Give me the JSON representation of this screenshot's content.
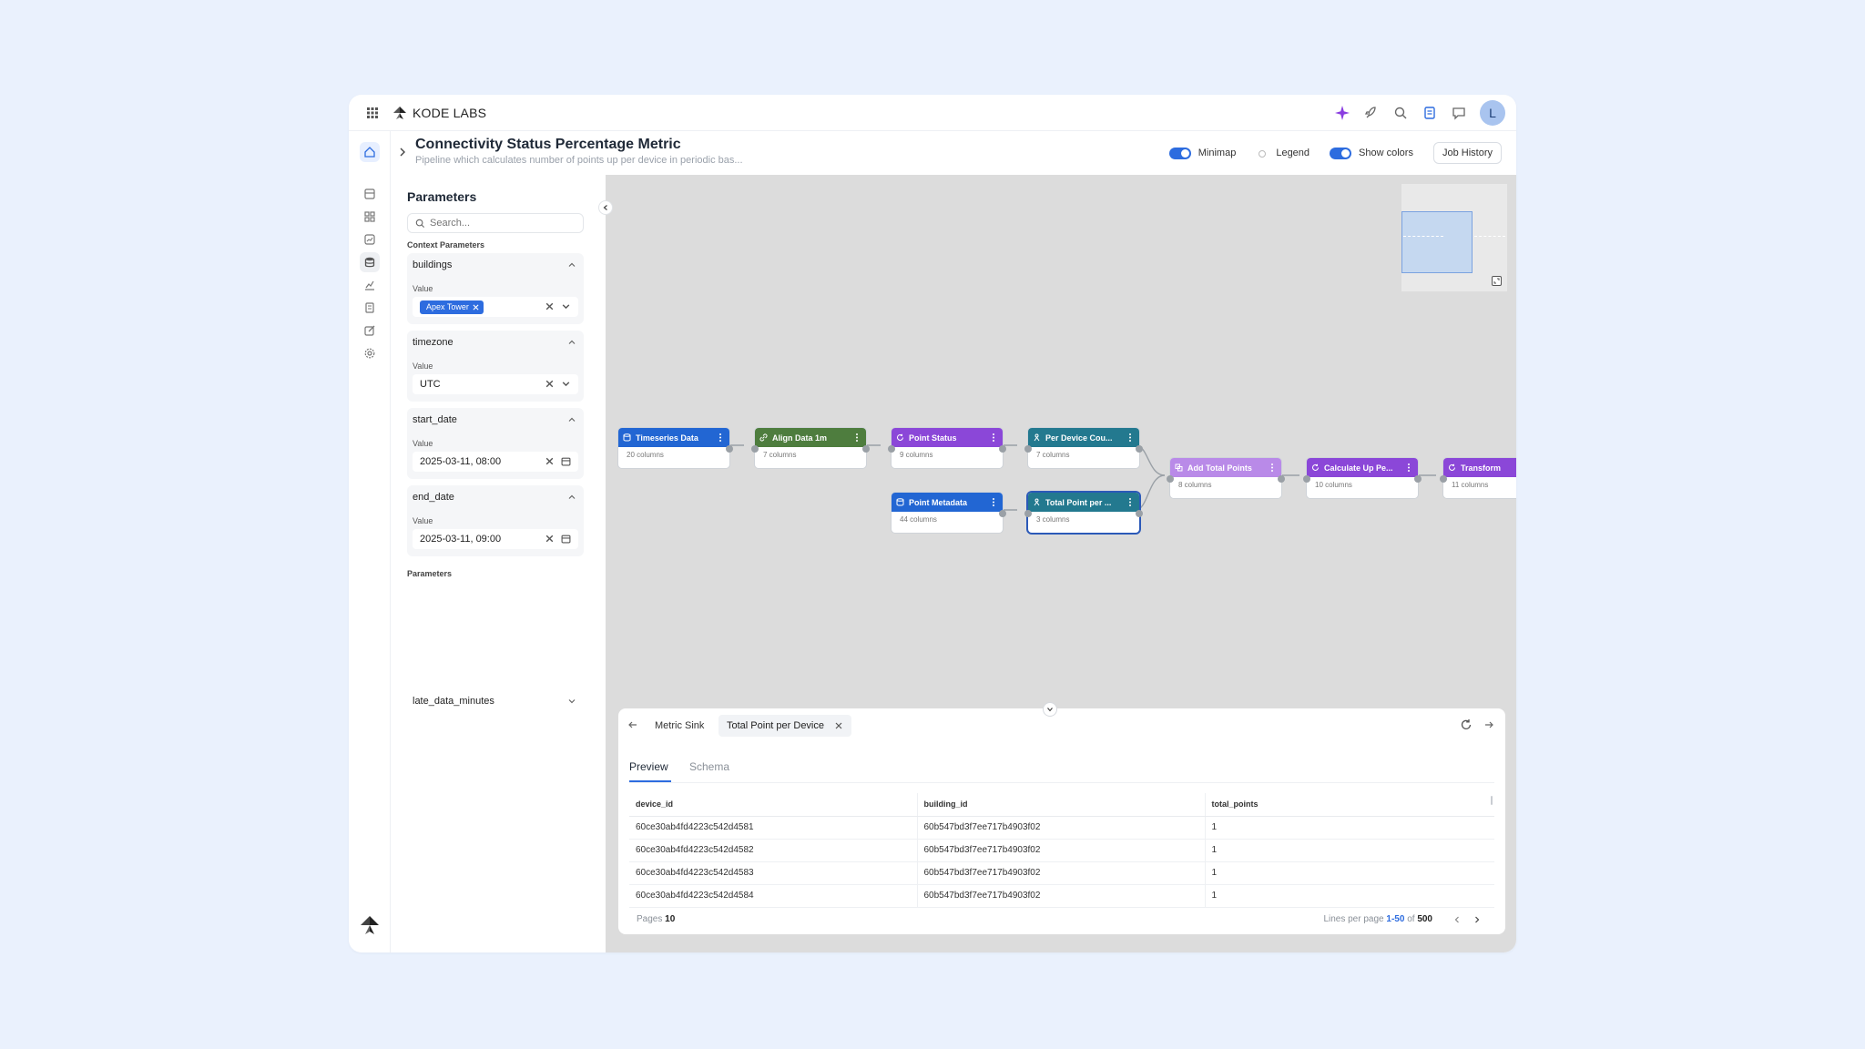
{
  "app": {
    "brand": "KODE LABS",
    "accent": "#2d6cdf",
    "avatar_initial": "L"
  },
  "topbar": {
    "icons": [
      "grid-icon",
      "sparkle-icon",
      "rocket-icon",
      "search-icon",
      "document-icon",
      "chat-icon"
    ]
  },
  "rail": {
    "items": [
      "home-icon",
      "dashboard-icon",
      "apps-icon",
      "analytics-icon",
      "database-icon",
      "chart-icon",
      "report-icon",
      "edit-icon",
      "settings-icon"
    ]
  },
  "header": {
    "title": "Connectivity Status Percentage Metric",
    "subtitle": "Pipeline which calculates number of points up per device in periodic bas...",
    "minimap_label": "Minimap",
    "legend_label": "Legend",
    "show_colors_label": "Show colors",
    "job_history_label": "Job History"
  },
  "params": {
    "title": "Parameters",
    "search_placeholder": "Search...",
    "context_label": "Context Parameters",
    "value_label": "Value",
    "buildings": {
      "name": "buildings",
      "chip": "Apex Tower"
    },
    "timezone": {
      "name": "timezone",
      "value": "UTC"
    },
    "start_date": {
      "name": "start_date",
      "value": "2025-03-11, 08:00"
    },
    "end_date": {
      "name": "end_date",
      "value": "2025-03-11, 09:00"
    },
    "params_label": "Parameters",
    "late": "late_data_minutes"
  },
  "nodes": {
    "timeseries": {
      "title": "Timeseries Data",
      "cols": "20 columns",
      "color": "#2266d3"
    },
    "align": {
      "title": "Align Data 1m",
      "cols": "7 columns",
      "color": "#4e7d3e"
    },
    "point_status": {
      "title": "Point Status",
      "cols": "9 columns",
      "color": "#8b47d8"
    },
    "per_device": {
      "title": "Per Device Cou...",
      "cols": "7 columns",
      "color": "#23798f"
    },
    "point_meta": {
      "title": "Point Metadata",
      "cols": "44 columns",
      "color": "#2266d3"
    },
    "total_point": {
      "title": "Total Point per ...",
      "cols": "3 columns",
      "color": "#23798f"
    },
    "add_total": {
      "title": "Add Total Points",
      "cols": "8 columns",
      "color": "#b98ae8"
    },
    "calc_up": {
      "title": "Calculate Up Pe...",
      "cols": "10 columns",
      "color": "#8b47d8"
    },
    "transform": {
      "title": "Transform",
      "cols": "11 columns",
      "color": "#8b47d8"
    }
  },
  "bottom": {
    "crumb1": "Metric Sink",
    "crumb2": "Total Point per Device",
    "tab_preview": "Preview",
    "tab_schema": "Schema",
    "columns": [
      "device_id",
      "building_id",
      "total_points"
    ],
    "rows": [
      [
        "60ce30ab4fd4223c542d4581",
        "60b547bd3f7ee717b4903f02",
        "1"
      ],
      [
        "60ce30ab4fd4223c542d4582",
        "60b547bd3f7ee717b4903f02",
        "1"
      ],
      [
        "60ce30ab4fd4223c542d4583",
        "60b547bd3f7ee717b4903f02",
        "1"
      ],
      [
        "60ce30ab4fd4223c542d4584",
        "60b547bd3f7ee717b4903f02",
        "1"
      ]
    ],
    "pages_label": "Pages",
    "pages_value": "10",
    "lines_label": "Lines per page",
    "range": "1-50",
    "of_label": "of",
    "total": "500"
  }
}
